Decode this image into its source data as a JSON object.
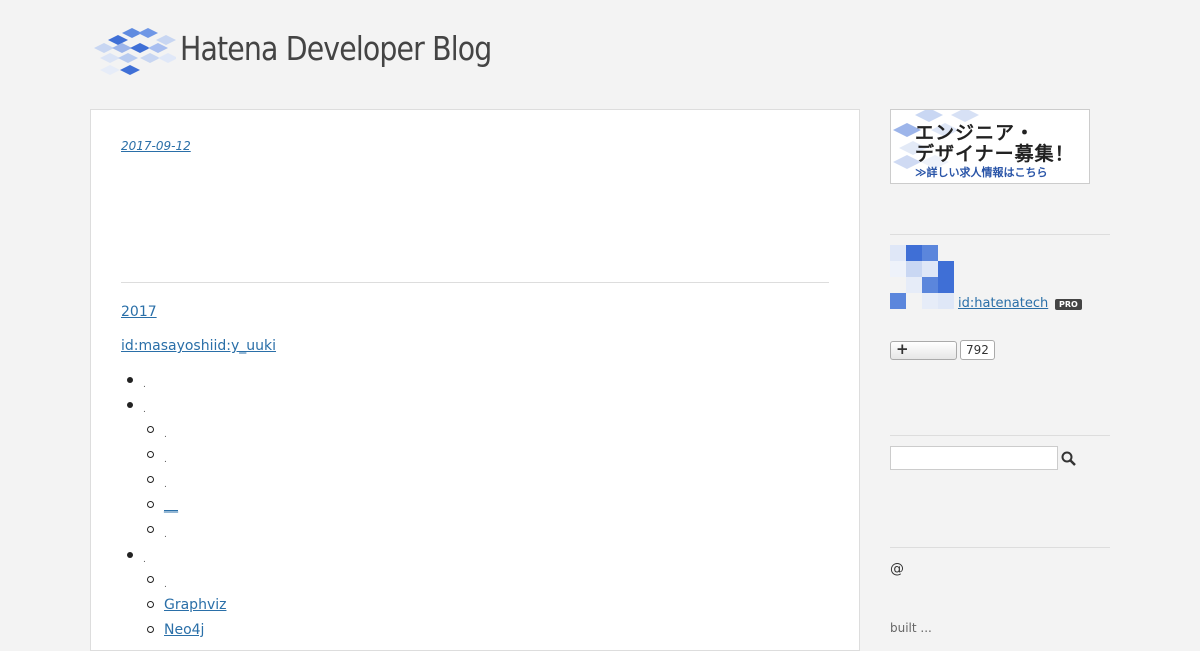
{
  "header": {
    "title": "Hatena Developer Blog"
  },
  "entry": {
    "date": "2017-09-12",
    "year_link": "2017",
    "author_link": "id:masayoshiid:y_uuki"
  },
  "toc": {
    "items": [
      {
        "level": 1,
        "text": ".",
        "link": false
      },
      {
        "level": 1,
        "text": ".",
        "link": false
      },
      {
        "level": 2,
        "text": ".",
        "link": false
      },
      {
        "level": 2,
        "text": ".",
        "link": false
      },
      {
        "level": 2,
        "text": ".",
        "link": false
      },
      {
        "level": 2,
        "text": "__",
        "link": true
      },
      {
        "level": 2,
        "text": ".",
        "link": false
      },
      {
        "level": 1,
        "text": ".",
        "link": false
      },
      {
        "level": 2,
        "text": ".",
        "link": false
      },
      {
        "level": 2,
        "text": "Graphviz",
        "link": true
      },
      {
        "level": 2,
        "text": "Neo4j",
        "link": true
      }
    ]
  },
  "sidebar": {
    "banner": {
      "line1": "エンジニア・",
      "line2": "デザイナー募集！",
      "line3": "≫詳しい求人情報はこちら"
    },
    "profile": {
      "id": "id:hatenatech",
      "badge": "PRO"
    },
    "subscribe": {
      "plus": "+",
      "count": "792"
    },
    "search": {
      "value": ""
    },
    "at_text": "@",
    "footer_text": "built ..."
  },
  "colors": {
    "link": "#2a6fa8",
    "background": "#f3f3f3",
    "logo_blue": "#3f6fd6"
  }
}
